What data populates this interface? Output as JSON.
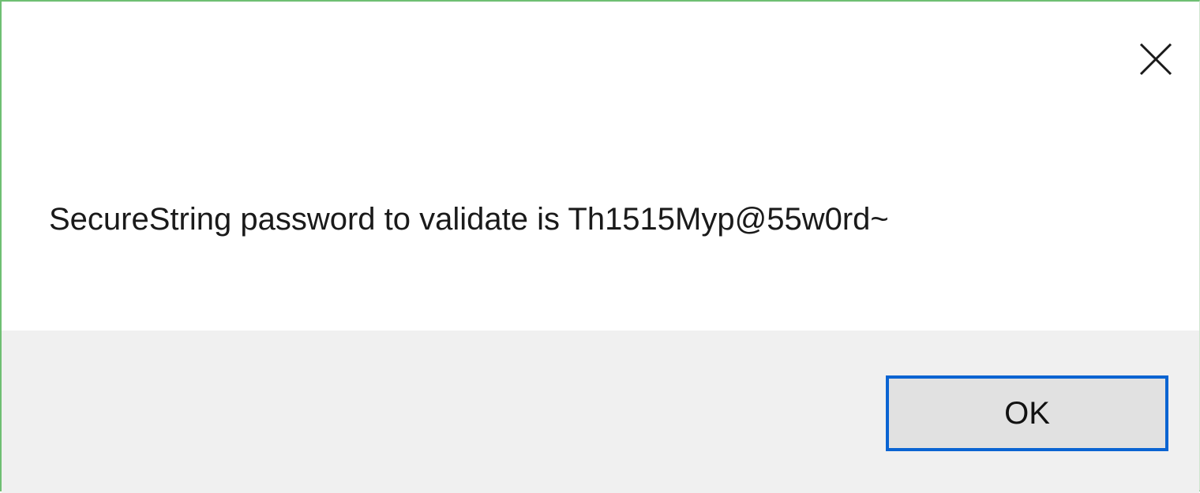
{
  "dialog": {
    "message": "SecureString password to validate is Th1515Myp@55w0rd~",
    "ok_label": "OK",
    "close_icon": "close-icon"
  },
  "colors": {
    "accent_border": "#0a64d2",
    "window_border": "#6fbf73",
    "footer_bg": "#f0f0f0",
    "button_bg": "#e1e1e1"
  }
}
